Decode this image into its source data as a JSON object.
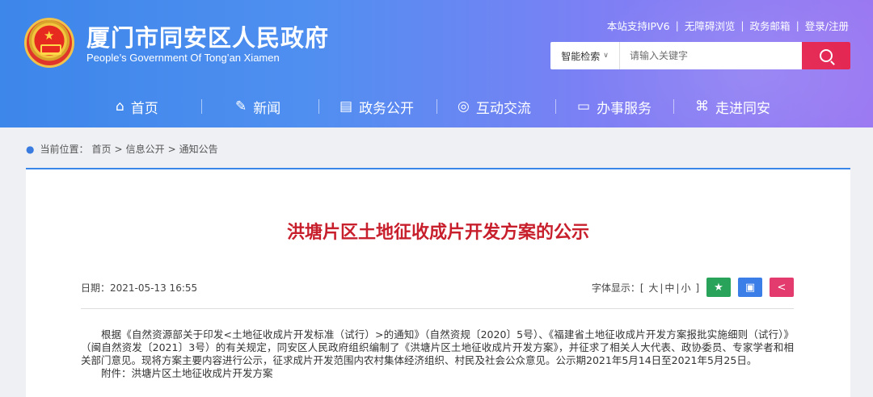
{
  "header": {
    "site_title": "厦门市同安区人民政府",
    "site_subtitle": "People’s Government Of Tong’an Xiamen",
    "top_links": [
      "本站支持IPV6",
      "无障碍浏览",
      "政务邮箱",
      "登录/注册"
    ],
    "search": {
      "category": "智能检索",
      "placeholder": "请输入关键字"
    }
  },
  "nav": {
    "items": [
      {
        "label": "首页",
        "icon": "home-icon"
      },
      {
        "label": "新闻",
        "icon": "news-icon"
      },
      {
        "label": "政务公开",
        "icon": "document-icon"
      },
      {
        "label": "互动交流",
        "icon": "chat-icon"
      },
      {
        "label": "办事服务",
        "icon": "monitor-icon"
      },
      {
        "label": "走进同安",
        "icon": "building-icon"
      }
    ]
  },
  "breadcrumb": {
    "prefix": "当前位置：",
    "items": [
      "首页",
      "信息公开",
      "通知公告"
    ]
  },
  "article": {
    "title": "洪塘片区土地征收成片开发方案的公示",
    "date": "日期：2021-05-13 16:55",
    "font_label": "字体显示：[",
    "font_sizes": [
      "大",
      "中",
      "小"
    ],
    "font_end": "]",
    "body_para1": "根据《自然资源部关于印发<土地征收成片开发标准（试行）>的通知》（自然资规〔2020〕5号）、《福建省土地征收成片开发方案报批实施细则（试行）》（闽自然资发〔2021〕3号）的有关规定，同安区人民政府组织编制了《洪塘片区土地征收成片开发方案》，并征求了相关人大代表、政协委员、专家学者和相关部门意见。现将方案主要内容进行公示，征求成片开发范围内农村集体经济组织、村民及社会公众意见。公示期2021年5月14日至2021年5月25日。",
    "attachment": "附件：洪塘片区土地征收成片开发方案"
  },
  "colors": {
    "header_start": "#3d86ea",
    "header_end": "#9a78f2",
    "title_red": "#c81f2c",
    "search_btn": "#e31e4c",
    "green_btn": "#29a35a",
    "blue_btn": "#3c7ee8",
    "pink_btn": "#e43b6f"
  }
}
